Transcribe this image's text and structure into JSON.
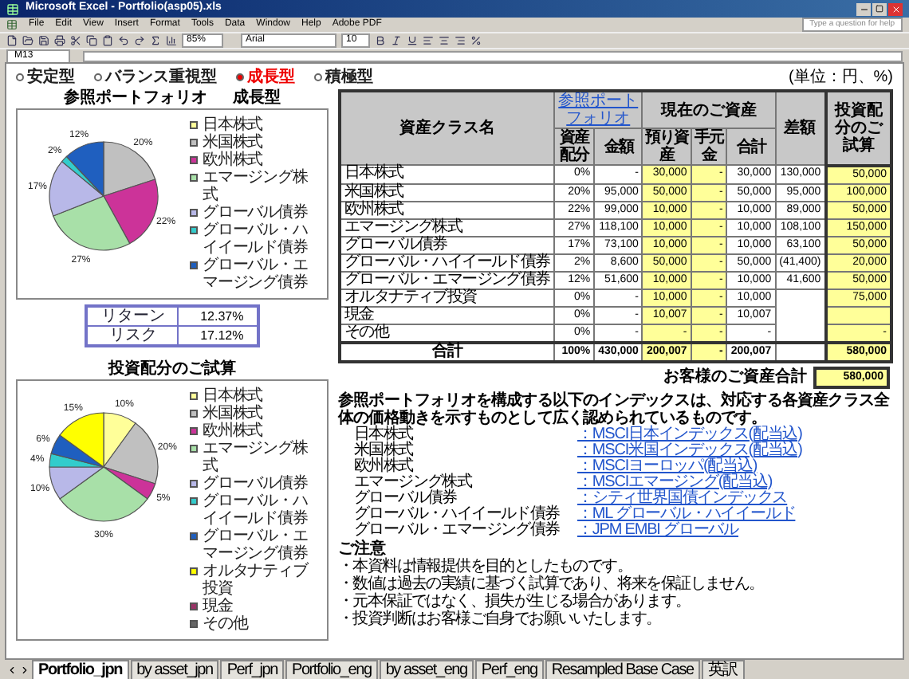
{
  "window": {
    "title": "Microsoft Excel - Portfolio(asp05).xls"
  },
  "menu": [
    "File",
    "Edit",
    "View",
    "Insert",
    "Format",
    "Tools",
    "Data",
    "Window",
    "Help",
    "Adobe PDF"
  ],
  "help_box": {
    "placeholder": "Type a question for help"
  },
  "toolbar": {
    "zoom": "85%",
    "font": "Arial",
    "font_size": "10"
  },
  "formula_bar": {
    "name_box": "M13"
  },
  "profiles": [
    {
      "label": "安定型",
      "selected": false
    },
    {
      "label": "バランス重視型",
      "selected": false
    },
    {
      "label": "成長型",
      "selected": true
    },
    {
      "label": "積極型",
      "selected": false
    }
  ],
  "reference_chart": {
    "title": "参照ポートフォリオ",
    "profile": "成長型",
    "chart_data": {
      "type": "pie",
      "categories": [
        "日本株式",
        "米国株式",
        "欧州株式",
        "エマージング株式",
        "グローバル債券",
        "グローバル・ハイイールド債券",
        "グローバル・エマージング債券"
      ],
      "values": [
        0,
        20,
        22,
        27,
        17,
        2,
        12
      ],
      "colors": [
        "#ffff99",
        "#c0c0c0",
        "#cc3399",
        "#a8e0a8",
        "#b8b8e8",
        "#33cccc",
        "#1f5fbf"
      ],
      "value_labels": [
        null,
        "20%",
        "22%",
        "27%",
        "17%",
        "2%",
        "12%"
      ],
      "legend": "right"
    }
  },
  "stats": [
    {
      "label": "リターン",
      "value": "12.37%"
    },
    {
      "label": "リスク",
      "value": "17.12%"
    }
  ],
  "allocation_chart": {
    "title": "投資配分のご試算",
    "chart_data": {
      "type": "pie",
      "categories": [
        "日本株式",
        "米国株式",
        "欧州株式",
        "エマージング株式",
        "グローバル債券",
        "グローバル・ハイイールド債券",
        "グローバル・エマージング債券",
        "オルタナティブ投資",
        "現金",
        "その他"
      ],
      "values": [
        10,
        20,
        5,
        30,
        10,
        4,
        6,
        15,
        0,
        0
      ],
      "colors": [
        "#ffff99",
        "#c0c0c0",
        "#cc3399",
        "#a8e0a8",
        "#b8b8e8",
        "#33cccc",
        "#1f5fbf",
        "#ffff00",
        "#993366",
        "#666666"
      ],
      "value_labels": [
        "10%",
        "20%",
        "5%",
        "30%",
        "10%",
        "4%",
        "6%",
        "15%",
        null,
        null
      ],
      "legend": "right"
    }
  },
  "unit_note": "(単位：円、%)",
  "table": {
    "header": {
      "asset": "資産クラス名",
      "reference": "参照ポートフォリオ",
      "current": "現在のご資産",
      "difference": "差額",
      "proposal": "投資配分のご試算"
    },
    "subheaders": [
      "資産配分",
      "金額",
      "預り資産",
      "手元金",
      "合計"
    ],
    "rows": [
      {
        "name": "日本株式",
        "cells": [
          "0%",
          "-",
          "30,000",
          "-",
          "30,000",
          "130,000",
          "50,000"
        ]
      },
      {
        "name": "米国株式",
        "cells": [
          "20%",
          "95,000",
          "50,000",
          "-",
          "50,000",
          "95,000",
          "100,000"
        ]
      },
      {
        "name": "欧州株式",
        "cells": [
          "22%",
          "99,000",
          "10,000",
          "-",
          "10,000",
          "89,000",
          "50,000"
        ]
      },
      {
        "name": "エマージング株式",
        "cells": [
          "27%",
          "118,100",
          "10,000",
          "-",
          "10,000",
          "108,100",
          "150,000"
        ]
      },
      {
        "name": "グローバル債券",
        "cells": [
          "17%",
          "73,100",
          "10,000",
          "-",
          "10,000",
          "63,100",
          "50,000"
        ]
      },
      {
        "name": "グローバル・ハイイールド債券",
        "cells": [
          "2%",
          "8,600",
          "50,000",
          "-",
          "50,000",
          "(41,400)",
          "20,000"
        ]
      },
      {
        "name": "グローバル・エマージング債券",
        "cells": [
          "12%",
          "51,600",
          "10,000",
          "-",
          "10,000",
          "41,600",
          "50,000"
        ]
      },
      {
        "name": "オルタナティブ投資",
        "cells": [
          "0%",
          "-",
          "10,000",
          "-",
          "10,000",
          null,
          "75,000"
        ]
      },
      {
        "name": "現金",
        "cells": [
          "0%",
          "-",
          "10,007",
          "-",
          "10,007",
          null,
          null
        ]
      },
      {
        "name": "その他",
        "cells": [
          "0%",
          "-",
          "-",
          "-",
          "-",
          null,
          "-"
        ]
      }
    ],
    "total": {
      "name": "合計",
      "cells": [
        "100%",
        "430,000",
        "200,007",
        "-",
        "200,007",
        null,
        "580,000"
      ]
    }
  },
  "assets_total": {
    "label": "お客様のご資産合計",
    "value": "580,000"
  },
  "index_note": "参照ポートフォリオを構成する以下のインデックスは、対応する各資産クラス全体の価格動きを示すものとして広く認められているものです。",
  "indices": [
    {
      "asset": "日本株式",
      "index": "：MSCI日本インデックス(配当込)"
    },
    {
      "asset": "米国株式",
      "index": "：MSCI米国インデックス(配当込)"
    },
    {
      "asset": "欧州株式",
      "index": "：MSCIヨーロッパ(配当込)"
    },
    {
      "asset": "エマージング株式",
      "index": "：MSCIエマージング(配当込)"
    },
    {
      "asset": "グローバル債券",
      "index": "：シティ世界国債インデックス"
    },
    {
      "asset": "グローバル・ハイイールド債券",
      "index": "：ML グローバル・ハイイールド"
    },
    {
      "asset": "グローバル・エマージング債券",
      "index": "：JPM EMBI グローバル"
    }
  ],
  "notes": {
    "title": "ご注意",
    "paragraphs": [
      "・本資料は情報提供を目的としたものです。",
      "・数値は過去の実績に基づく試算であり、将来を保証しません。",
      "・元本保証ではなく、損失が生じる場合があります。",
      "・投資判断はお客様ご自身でお願いいたします。"
    ]
  },
  "sheet_tabs": [
    {
      "label": "Portfolio_jpn",
      "selected": true
    },
    {
      "label": "by asset_jpn",
      "selected": false
    },
    {
      "label": "Perf_jpn",
      "selected": false
    },
    {
      "label": "Portfolio_eng",
      "selected": false
    },
    {
      "label": "by asset_eng",
      "selected": false
    },
    {
      "label": "Perf_eng",
      "selected": false
    },
    {
      "label": "Resampled Base Case",
      "selected": false
    },
    {
      "label": "英訳",
      "selected": false
    }
  ]
}
